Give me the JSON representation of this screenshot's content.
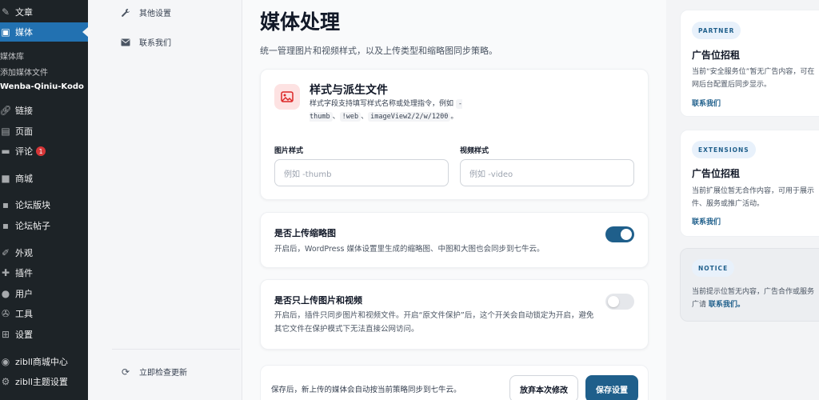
{
  "wp_menu": {
    "posts": "文章",
    "media": "媒体",
    "media_sub": [
      "媒体库",
      "添加媒体文件",
      "Wenba-Qiniu-Kodo"
    ],
    "links": "链接",
    "pages": "页面",
    "comments": "评论",
    "comments_count": "1",
    "shop": "商城",
    "forum_boards": "论坛版块",
    "forum_posts": "论坛帖子",
    "appearance": "外观",
    "plugins": "插件",
    "users": "用户",
    "tools": "工具",
    "settings": "设置",
    "zibll_shop_center": "zibll商城中心",
    "zibll_theme_settings": "zibll主题设置"
  },
  "settings_nav": {
    "other_settings": "其他设置",
    "contact_us": "联系我们",
    "check_updates": "立即检查更新"
  },
  "main": {
    "title": "媒体处理",
    "description": "统一管理图片和视频样式，以及上传类型和缩略图同步策略。",
    "styles_card": {
      "title": "样式与派生文件",
      "subtitle_prefix": "样式字段支持填写样式名称或处理指令，例如",
      "examples": [
        "-thumb",
        "!web",
        "imageView2/2/w/1200"
      ],
      "sep": "、",
      "end": "。",
      "image_style_label": "图片样式",
      "image_style_placeholder": "例如 -thumb",
      "video_style_label": "视频样式",
      "video_style_placeholder": "例如 -video"
    },
    "upload_thumbs": {
      "title": "是否上传缩略图",
      "description": "开启后，WordPress 媒体设置里生成的缩略图、中图和大图也会同步到七牛云。",
      "enabled": true
    },
    "only_images_videos": {
      "title": "是否只上传图片和视频",
      "description": "开启后，插件只同步图片和视频文件。开启“原文件保护”后，这个开关会自动锁定为开启，避免其它文件在保护模式下无法直接公网访问。",
      "enabled": false
    },
    "footer": {
      "text": "保存后，新上传的媒体会自动按当前策略同步到七牛云。",
      "discard": "放弃本次修改",
      "save": "保存设置"
    }
  },
  "ads": [
    {
      "tag": "PARTNER",
      "title": "广告位招租",
      "text_lines": [
        "当前“安全服务位”暂无广告内容，可在",
        "网后台配置后同步显示。"
      ],
      "link": "联系我们"
    },
    {
      "tag": "EXTENSIONS",
      "title": "广告位招租",
      "text_lines": [
        "当前扩展位暂无合作内容，可用于展示",
        "件、服务或推广活动。"
      ],
      "link": "联系我们"
    },
    {
      "tag": "NOTICE",
      "text_lines": [
        "当前提示位暂无内容，广告合作或服务"
      ],
      "text_prefix": "广请 ",
      "link": "联系我们。"
    }
  ],
  "colors": {
    "accent": "#1f5f8b",
    "wp_sidebar": "#1d2327",
    "wp_active": "#2271b1"
  }
}
